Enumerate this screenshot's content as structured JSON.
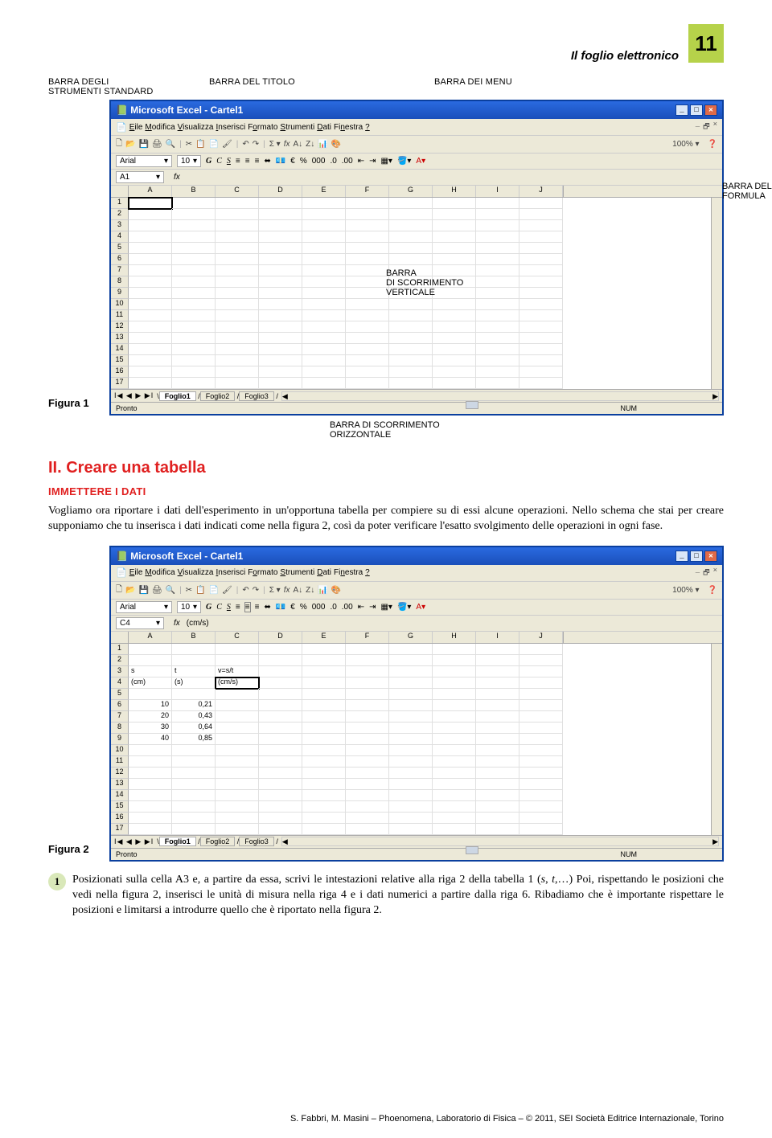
{
  "page": {
    "header_title": "Il foglio elettronico",
    "number": "11"
  },
  "labels": {
    "toolbar_std": "BARRA DEGLI\nSTRUMENTI STANDARD",
    "title_bar": "BARRA DEL TITOLO",
    "menu_bar": "BARRA DEI MENU",
    "formula_bar": "BARRA DELLA\nFORMULA",
    "vscroll": "BARRA\nDI SCORRIMENTO\nVERTICALE",
    "hscroll": "BARRA DI SCORRIMENTO\nORIZZONTALE"
  },
  "figure1_label": "Figura 1",
  "figure2_label": "Figura 2",
  "excel": {
    "title": "Microsoft Excel - Cartel1",
    "menus": [
      "Eile",
      "Modifica",
      "Visualizza",
      "Inserisci",
      "Formato",
      "Strumenti",
      "Dati",
      "Finestra",
      "?"
    ],
    "font": "Arial",
    "font_size": "10",
    "zoom": "100%",
    "columns": [
      "A",
      "B",
      "C",
      "D",
      "E",
      "F",
      "G",
      "H",
      "I",
      "J"
    ],
    "rows17": [
      "1",
      "2",
      "3",
      "4",
      "5",
      "6",
      "7",
      "8",
      "9",
      "10",
      "11",
      "12",
      "13",
      "14",
      "15",
      "16",
      "17"
    ],
    "name_box_1": "A1",
    "fx_1": "",
    "name_box_2": "C4",
    "fx_2": "(cm/s)",
    "sheets": [
      "Foglio1",
      "Foglio2",
      "Foglio3"
    ],
    "status": "Pronto",
    "num": "NUM"
  },
  "fig2_data": {
    "r3": {
      "A": "s",
      "B": "t",
      "C": "v=s/t"
    },
    "r4": {
      "A": "(cm)",
      "B": "(s)",
      "C": "(cm/s)"
    },
    "r6": {
      "A": "10",
      "B": "0,21"
    },
    "r7": {
      "A": "20",
      "B": "0,43"
    },
    "r8": {
      "A": "30",
      "B": "0,64"
    },
    "r9": {
      "A": "40",
      "B": "0,85"
    }
  },
  "section": {
    "h2": "II. Creare una tabella",
    "h3": "IMMETTERE I DATI",
    "p": "Vogliamo ora riportare i dati dell'esperimento in un'opportuna tabella per compiere su di essi alcune operazioni. Nello schema che stai per creare supponiamo che tu inserisca i dati indicati come nella figura 2, così da poter verificare l'esatto svolgimento delle operazioni in ogni fase."
  },
  "step1": {
    "num": "1",
    "text_a": "Posizionati sulla cella A3 e, a partire da essa, scrivi le intestazioni relative alla riga 2 della tabella 1 (",
    "italic1": "s",
    "sep": ", ",
    "italic2": "t",
    "text_b": ",…) Poi, rispettando le posizioni che vedi nella figura 2, inserisci le unità di misura nella riga 4 e i dati numerici a partire dalla riga 6. Ribadiamo che è importante rispettare le posizioni e limitarsi a introdurre quello che è riportato nella figura 2."
  },
  "footer": "S. Fabbri, M. Masini – Phoenomena, Laboratorio di Fisica – © 2011, SEI Società Editrice Internazionale, Torino"
}
